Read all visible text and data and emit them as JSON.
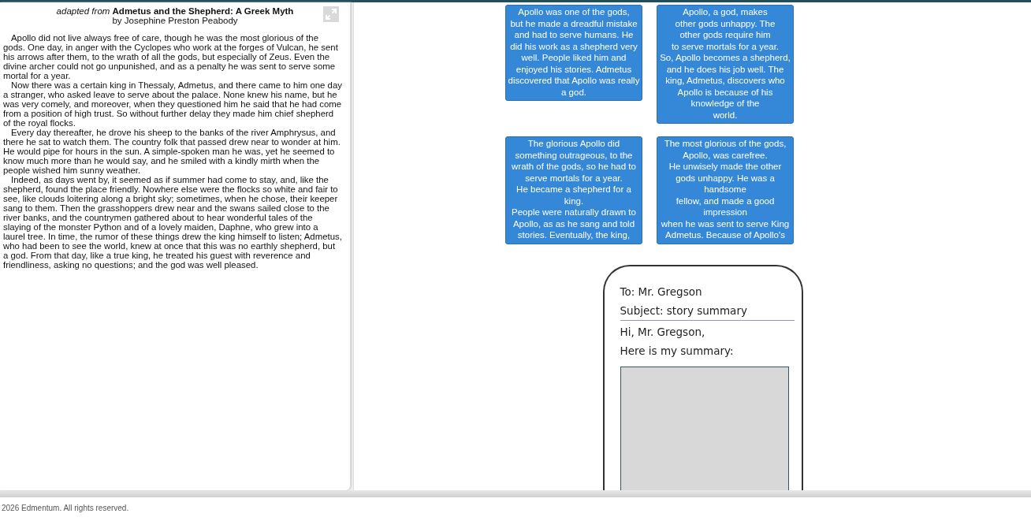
{
  "passage": {
    "source_prefix": "adapted from",
    "title": "Admetus and the Shepherd: A Greek Myth",
    "byline": "by Josephine Preston Peabody",
    "paragraphs": [
      "Apollo did not live always free of care, though he was the most glorious of the gods. One day, in anger with the Cyclopes who work at the forges of Vulcan, he sent his arrows after them, to the wrath of all the gods, but especially of Zeus. Even the divine archer could not go unpunished, and as a penalty he was sent to serve some mortal for a year.",
      "Now there was a certain king in Thessaly, Admetus, and there came to him one day a stranger, who asked leave to serve about the palace. None knew his name, but he was very comely, and moreover, when they questioned him he said that he had come from a position of high trust. So without further delay they made him chief shepherd of the royal flocks.",
      "Every day thereafter, he drove his sheep to the banks of the river Amphrysus, and there he sat to watch them. The country folk that passed drew near to wonder at him. He would pipe for hours in the sun. A simple-spoken man he was, yet he seemed to know much more than he would say, and he smiled with a kindly mirth when the people wished him sunny weather.",
      "Indeed, as days went by, it seemed as if summer had come to stay, and, like the shepherd, found the place friendly. Nowhere else were the flocks so white and fair to see, like clouds loitering along a bright sky; sometimes, when he chose, their keeper sang to them. Then the grasshoppers drew near and the swans sailed close to the river banks, and the countrymen gathered about to hear wonderful tales of the slaying of the monster Python and of a lovely maiden, Daphne, who grew into a laurel tree. In time, the rumor of these things drew the king himself to listen; Admetus, who had been to see the world, knew at once that this was no earthly shepherd, but a god. From that day, like a true king, he treated his guest with reverence and friendliness, asking no questions; and the god was well pleased."
    ]
  },
  "summary_options": [
    {
      "text": "Apollo was one of the gods,\nbut he made a dreadful mistake and had to serve humans. He did his work as a shepherd very well. People liked him and enjoyed his stories. Admetus discovered that Apollo was really a god."
    },
    {
      "text": "Apollo, a god, makes\nother gods unhappy. The\nother gods require him\nto serve mortals for a year.\nSo, Apollo becomes a shepherd, and he does his job well. The king, Admetus, discovers who Apollo is because of his\nknowledge of the\nworld."
    },
    {
      "text": "The glorious Apollo did something outrageous, to the wrath of the gods, so he had to serve mortals for a year.\nHe became a shepherd for a king.\nPeople were naturally drawn to Apollo, as as he sang and told stories. Eventually, the king,"
    },
    {
      "text": "The most glorious of the gods, Apollo, was carefree.\nHe unwisely made the other gods unhappy. He was a handsome\nfellow, and made a good impression\nwhen he was sent to serve King Admetus. Because of Apollo's"
    }
  ],
  "email": {
    "to": "To: Mr. Gregson",
    "subject": "Subject: story summary",
    "greeting": "Hi, Mr. Gregson,",
    "intro": "Here is my summary:"
  },
  "footer": "2026 Edmentum. All rights reserved."
}
